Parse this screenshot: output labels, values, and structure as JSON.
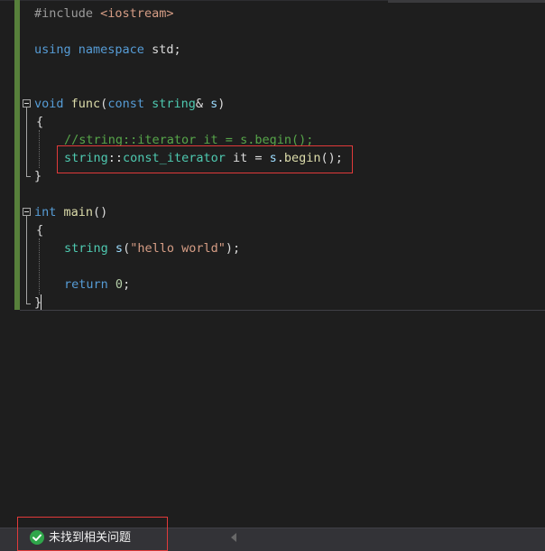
{
  "colors": {
    "editor_bg": "#1e1e1e",
    "keyword": "#569cd6",
    "type": "#4ec9b0",
    "function": "#dcdcaa",
    "parameter": "#9cdcfe",
    "string": "#d69d85",
    "number": "#b5cea8",
    "comment": "#57a64a",
    "change_bar": "#57803b",
    "highlight_box": "#e03a3a",
    "status_ok": "#2fa64a"
  },
  "code": {
    "l1": {
      "directive": "#include",
      "space": " ",
      "header": "<iostream>"
    },
    "l2": {
      "kw1": "using",
      "s1": " ",
      "kw2": "namespace",
      "rest": " std;"
    },
    "l3": {
      "kw": "void",
      "s1": " ",
      "fn": "func",
      "p1": "(",
      "kw2": "const",
      "s2": " ",
      "ty": "string",
      "p2": "& ",
      "param": "s",
      "p3": ")"
    },
    "l4": {
      "brace": "{"
    },
    "l5": {
      "comment": "//string::iterator it = s.begin();"
    },
    "l6": {
      "ty": "string",
      "p1": "::",
      "ty2": "const_iterator",
      "p2": " it = ",
      "param": "s",
      "p3": ".",
      "fn": "begin",
      "p4": "();"
    },
    "l7": {
      "brace": "}"
    },
    "l8": {
      "kw": "int",
      "s1": " ",
      "fn": "main",
      "p1": "()"
    },
    "l9": {
      "brace": "{"
    },
    "l10": {
      "ty": "string",
      "s1": " ",
      "var": "s",
      "p1": "(",
      "str": "\"hello world\"",
      "p2": ");"
    },
    "l11": {
      "kw": "return",
      "s1": " ",
      "num": "0",
      "p1": ";"
    },
    "l12": {
      "brace": "}"
    }
  },
  "status": {
    "icon": "check-circle-icon",
    "text": "未找到相关问题"
  }
}
